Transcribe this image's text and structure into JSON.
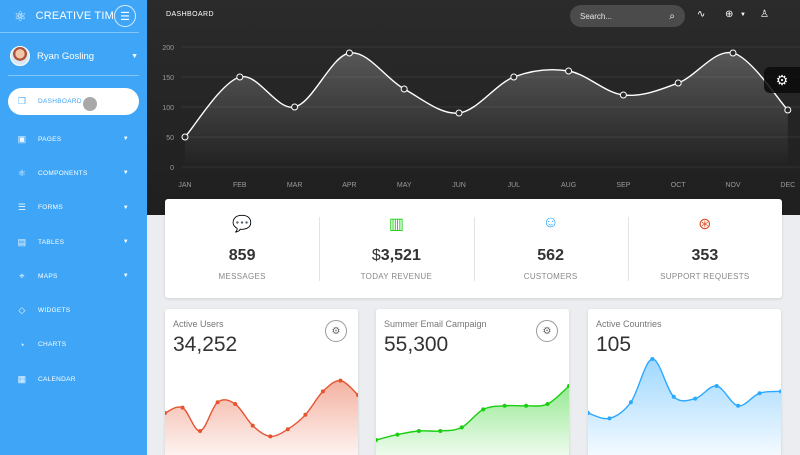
{
  "sidebar": {
    "brand": "CREATIVE TIM",
    "user_name": "Ryan Gosling",
    "items": [
      {
        "label": "DASHBOARD",
        "icon": "cube-icon",
        "glyph": "❒"
      },
      {
        "label": "PAGES",
        "icon": "image-icon",
        "glyph": "▣"
      },
      {
        "label": "COMPONENTS",
        "icon": "atom-icon",
        "glyph": "⚛"
      },
      {
        "label": "FORMS",
        "icon": "list-icon",
        "glyph": "☰"
      },
      {
        "label": "TABLES",
        "icon": "table-icon",
        "glyph": "▤"
      },
      {
        "label": "MAPS",
        "icon": "pin-icon",
        "glyph": "⌖"
      },
      {
        "label": "WIDGETS",
        "icon": "diamond-icon",
        "glyph": "◇"
      },
      {
        "label": "CHARTS",
        "icon": "chart-pie-icon",
        "glyph": "◔"
      },
      {
        "label": "CALENDAR",
        "icon": "calendar-icon",
        "glyph": "▦"
      }
    ]
  },
  "header": {
    "title": "DASHBOARD",
    "search_placeholder": "Search..."
  },
  "stats": [
    {
      "value": "859",
      "label": "MESSAGES",
      "icon": "chat-icon",
      "glyph": "💬",
      "color": "#e14e24"
    },
    {
      "value": "3,521",
      "prefix": "$",
      "label": "TODAY REVENUE",
      "icon": "money-icon",
      "glyph": "▥",
      "color": "#18ce0f"
    },
    {
      "value": "562",
      "label": "CUSTOMERS",
      "icon": "user-icon",
      "glyph": "☺",
      "color": "#2ca8ff"
    },
    {
      "value": "353",
      "label": "SUPPORT REQUESTS",
      "icon": "support-icon",
      "glyph": "⊛",
      "color": "#e14e24"
    }
  ],
  "cards": [
    {
      "title": "Active Users",
      "value": "34,252",
      "color": "#e6542f",
      "points": [
        20,
        23,
        10,
        26,
        25,
        13,
        7,
        11,
        19,
        32,
        38,
        30
      ]
    },
    {
      "title": "Summer Email Campaign",
      "value": "55,300",
      "color": "#18ce0f",
      "points": [
        5,
        8,
        10,
        10,
        12,
        22,
        24,
        24,
        25,
        35
      ]
    },
    {
      "title": "Active Countries",
      "value": "105",
      "color": "#2ca8ff",
      "points": [
        20,
        17,
        26,
        50,
        29,
        28,
        35,
        24,
        31,
        32
      ]
    }
  ],
  "chart_data": {
    "type": "line",
    "categories": [
      "JAN",
      "FEB",
      "MAR",
      "APR",
      "MAY",
      "JUN",
      "JUL",
      "AUG",
      "SEP",
      "OCT",
      "NOV",
      "DEC"
    ],
    "values": [
      50,
      150,
      100,
      190,
      130,
      90,
      150,
      160,
      120,
      140,
      190,
      95
    ],
    "ylim": [
      0,
      200
    ],
    "yticks": [
      0,
      50,
      100,
      150,
      200
    ],
    "grid": true
  }
}
